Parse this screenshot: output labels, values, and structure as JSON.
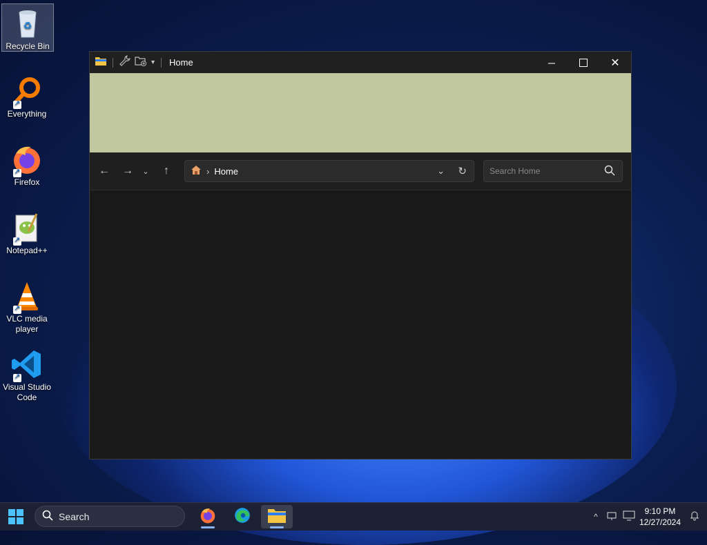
{
  "desktop": {
    "icons": [
      {
        "label": "Recycle Bin",
        "icon": "recycle-bin-icon"
      },
      {
        "label": "Everything",
        "icon": "everything-search-icon"
      },
      {
        "label": "Firefox",
        "icon": "firefox-icon"
      },
      {
        "label": "Notepad++",
        "icon": "notepad-plus-plus-icon"
      },
      {
        "label": "VLC media player",
        "icon": "vlc-cone-icon"
      },
      {
        "label": "Visual Studio Code",
        "icon": "vscode-icon"
      }
    ]
  },
  "window": {
    "title": "Home",
    "ribbon_color": "#c1c79e",
    "address": {
      "location": "Home"
    },
    "search": {
      "placeholder": "Search Home"
    }
  },
  "taskbar": {
    "search_label": "Search",
    "apps": [
      {
        "name": "Firefox",
        "icon": "firefox-icon"
      },
      {
        "name": "Microsoft Edge",
        "icon": "edge-icon"
      },
      {
        "name": "File Explorer",
        "icon": "file-explorer-icon",
        "active": true
      }
    ],
    "clock": {
      "time": "9:10 PM",
      "date": "12/27/2024"
    },
    "accent": "#4cc2ff"
  }
}
